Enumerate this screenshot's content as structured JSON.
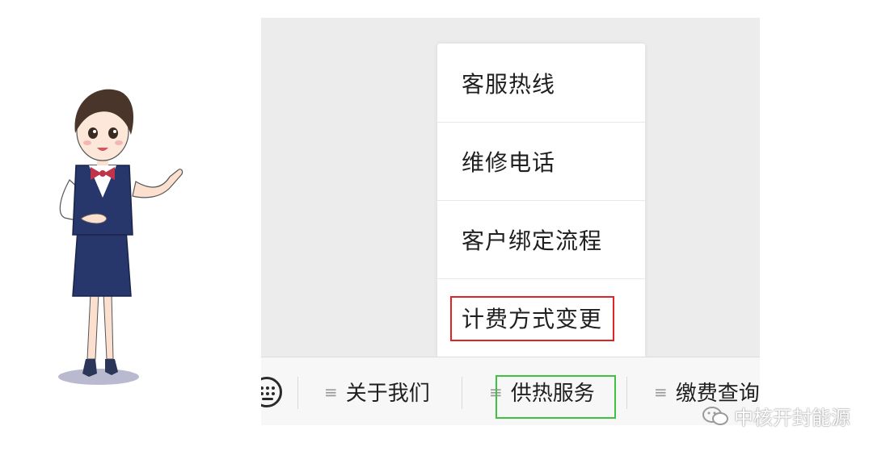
{
  "menu": {
    "items": [
      {
        "label": "客服热线"
      },
      {
        "label": "维修电话"
      },
      {
        "label": "客户绑定流程"
      },
      {
        "label": "计费方式变更"
      }
    ],
    "highlighted_index": 3,
    "highlight_color": "#e02424"
  },
  "menubar": {
    "keyboard_icon": "keyboard-icon",
    "tabs": [
      {
        "label": "关于我们"
      },
      {
        "label": "供热服务"
      },
      {
        "label": "缴费查询"
      }
    ],
    "highlighted_index": 1,
    "highlight_color": "#3fc23f",
    "menu_icon": "hamburger-icon"
  },
  "watermark": {
    "text": "中核开封能源",
    "icon": "wechat-icon"
  },
  "illustration": {
    "subject": "customer-service-agent",
    "uniform_color": "#27366b"
  }
}
